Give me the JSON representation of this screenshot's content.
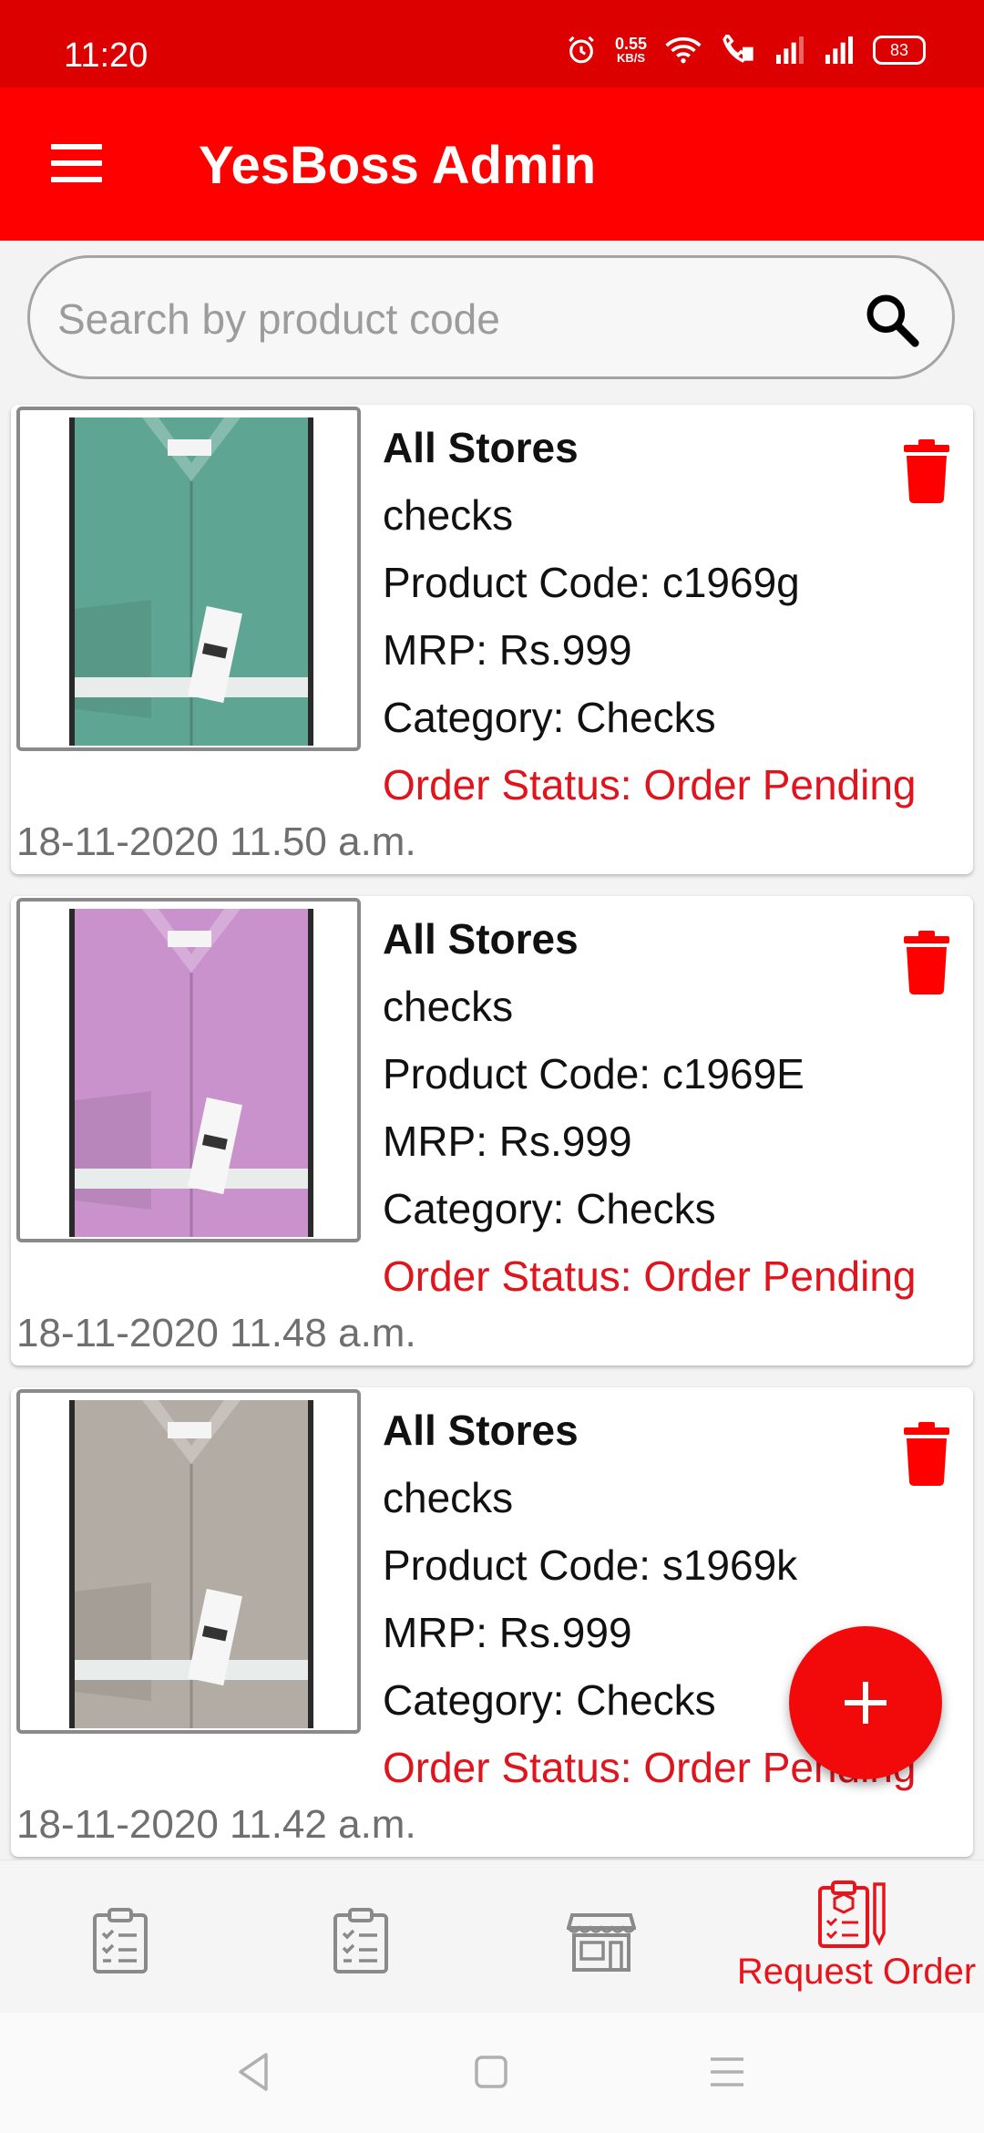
{
  "status_bar": {
    "time": "11:20",
    "net_speed_value": "0.55",
    "net_speed_unit": "KB/S",
    "battery": "83"
  },
  "app_bar": {
    "title": "YesBoss Admin"
  },
  "search": {
    "placeholder": "Search by product code"
  },
  "products": [
    {
      "store": "All Stores",
      "name": "checks",
      "code": "Product Code: c1969g",
      "mrp": "MRP: Rs.999",
      "category": "Category: Checks",
      "status": "Order Status: Order Pending",
      "date": "18-11-2020 11.50 a.m.",
      "shirt_color": "#5fa593"
    },
    {
      "store": "All Stores",
      "name": "checks",
      "code": "Product Code: c1969E",
      "mrp": "MRP: Rs.999",
      "category": "Category: Checks",
      "status": "Order Status: Order Pending",
      "date": "18-11-2020 11.48 a.m.",
      "shirt_color": "#c992cc"
    },
    {
      "store": "All Stores",
      "name": "checks",
      "code": "Product Code: s1969k",
      "mrp": "MRP: Rs.999",
      "category": "Category: Checks",
      "status": "Order Status: Order Pending",
      "date": "18-11-2020 11.42 a.m.",
      "shirt_color": "#b3aca4"
    }
  ],
  "bottom_nav": {
    "active_label": "Request Order",
    "icons": [
      "clipboard-list-icon",
      "clipboard-list-icon",
      "store-icon",
      "request-order-icon"
    ]
  },
  "colors": {
    "status_bar": "#dc0000",
    "app_bar": "#ff0000",
    "accent": "#e0141c"
  }
}
